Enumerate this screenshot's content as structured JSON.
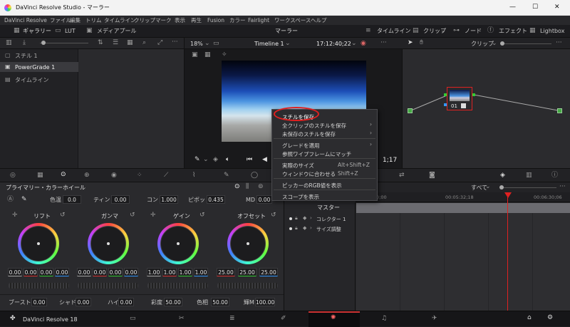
{
  "window": {
    "title": "DaVinci Resolve Studio - マーラー",
    "controls": [
      "—",
      "☐",
      "✕"
    ]
  },
  "menu": [
    "DaVinci Resolve",
    "ファイル",
    "編集",
    "トリム",
    "タイムライン",
    "クリップ",
    "マーク",
    "表示",
    "再生",
    "Fusion",
    "カラー",
    "Fairlight",
    "ワークスペース",
    "ヘルプ"
  ],
  "toolbar": {
    "gallery": "ギャラリー",
    "lut": "LUT",
    "media_pool": "メディアプール",
    "project": "マーラー",
    "timeline": "タイムライン",
    "clip": "クリップ",
    "node": "ノード",
    "effects": "エフェクト",
    "lightbox": "Lightbox"
  },
  "viewer": {
    "zoom": "18%",
    "timeline_name": "Timeline 1",
    "timecode": "17:12:40;22",
    "time_right": "1;17"
  },
  "gallery": {
    "items": [
      "スチル 1",
      "PowerGrade 1",
      "タイムライン"
    ]
  },
  "nodes": {
    "mode": "クリップ",
    "node_label": "01"
  },
  "context_menu": {
    "items": [
      {
        "label": "スチルを保存",
        "shortcut": "",
        "submenu": false
      },
      {
        "label": "全クリップのスチルを保存",
        "shortcut": "",
        "submenu": true
      },
      {
        "label": "未保存のスチルを保存",
        "shortcut": "",
        "submenu": true
      },
      {
        "label": "グレードを適用",
        "shortcut": "",
        "submenu": true
      },
      {
        "label": "参照ワイプフレームにマッチ",
        "shortcut": "",
        "submenu": false
      },
      {
        "label": "実際のサイズ",
        "shortcut": "Alt+Shift+Z",
        "submenu": false
      },
      {
        "label": "ウィンドウに合わせる",
        "shortcut": "Shift+Z",
        "submenu": false
      },
      {
        "label": "ピッカーのRGB値を表示",
        "shortcut": "",
        "submenu": false
      },
      {
        "label": "スコープを表示",
        "shortcut": "",
        "submenu": false
      }
    ],
    "highlight_color": "#e02020"
  },
  "color": {
    "panel_title": "プライマリー・カラーホイール",
    "temp_label": "色温",
    "temp": "0.0",
    "tint_label": "ティント",
    "tint": "0.00",
    "contrast_label": "コン",
    "contrast": "1.000",
    "pivot_label": "ピボット",
    "pivot": "0.435",
    "md_label": "MD",
    "md": "0.00",
    "wheels": [
      {
        "name": "リフト",
        "values": [
          "0.00",
          "0.00",
          "0.00",
          "0.00"
        ]
      },
      {
        "name": "ガンマ",
        "values": [
          "0.00",
          "0.00",
          "0.00",
          "0.00"
        ]
      },
      {
        "name": "ゲイン",
        "values": [
          "1.00",
          "1.00",
          "1.00",
          "1.00"
        ]
      },
      {
        "name": "オフセット",
        "values": [
          "25.00",
          "25.00",
          "25.00"
        ]
      }
    ],
    "boost_label": "ブースト",
    "boost": "0.00",
    "shadow_label": "シャド",
    "shadow": "0.00",
    "highlight_label": "ハイ",
    "highlight": "0.00",
    "sat_label": "彩度",
    "sat": "50.00",
    "hue_label": "色相",
    "hue": "50.00",
    "lum_label": "輝M",
    "lum": "100.00"
  },
  "timeline": {
    "filter": "すべて",
    "timecodes": [
      "00:00:00;00",
      "00:05:32;18",
      "00:06:30;06"
    ],
    "master": "マスター",
    "tracks": [
      "コレクター 1",
      "サイズ調整"
    ],
    "playhead_color": "#e02020"
  },
  "bottom": {
    "app_name": "DaVinci Resolve 18"
  }
}
